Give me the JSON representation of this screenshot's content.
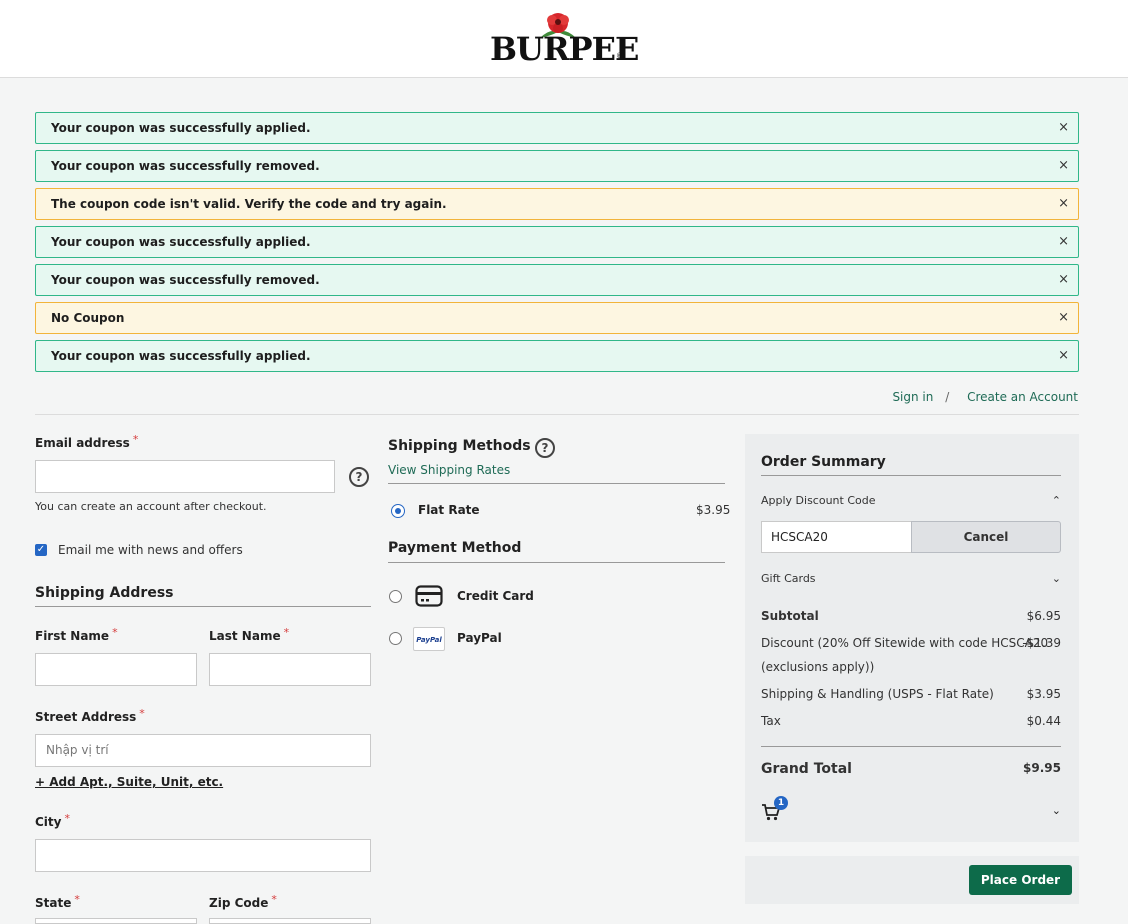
{
  "header": {
    "logo_text": "BURPEE",
    "logo_reg": "®"
  },
  "messages": [
    {
      "text": "Your coupon was successfully applied.",
      "type": "success"
    },
    {
      "text": "Your coupon was successfully removed.",
      "type": "success"
    },
    {
      "text": "The coupon code isn't valid. Verify the code and try again.",
      "type": "warning"
    },
    {
      "text": "Your coupon was successfully applied.",
      "type": "success"
    },
    {
      "text": "Your coupon was successfully removed.",
      "type": "success"
    },
    {
      "text": "No Coupon",
      "type": "warning"
    },
    {
      "text": "Your coupon was successfully applied.",
      "type": "success"
    }
  ],
  "close_glyph": "×",
  "auth": {
    "sign_in": "Sign in",
    "separator": "/",
    "create": "Create an Account"
  },
  "form": {
    "email_label": "Email address",
    "required_mark": "*",
    "email_note": "You can create an account after checkout.",
    "newsletter_label": "Email me with news and offers",
    "shipping_title": "Shipping Address",
    "first_name_label": "First Name",
    "last_name_label": "Last Name",
    "street_label": "Street Address",
    "street_placeholder": "Nhập vị trí",
    "add_apt": "+ Add Apt., Suite, Unit, etc.",
    "city_label": "City",
    "state_label": "State",
    "zip_label": "Zip Code"
  },
  "shipping": {
    "title": "Shipping Methods",
    "view_rates": "View Shipping Rates",
    "method_label": "Flat Rate",
    "method_price": "$3.95"
  },
  "payment": {
    "title": "Payment Method",
    "options": [
      {
        "label": "Credit Card",
        "icon": "credit-card-icon"
      },
      {
        "label": "PayPal",
        "icon": "paypal-icon",
        "icon_text": "PayPal"
      }
    ]
  },
  "summary": {
    "title": "Order Summary",
    "discount_label": "Apply Discount Code",
    "coupon_value": "HCSCA20",
    "cancel_label": "Cancel",
    "gift_cards_label": "Gift Cards",
    "subtotal_label": "Subtotal",
    "subtotal_value": "$6.95",
    "discount_line1": "Discount (20% Off Sitewide with code HCSCA20",
    "discount_line2": "(exclusions apply))",
    "discount_value": "-$1.39",
    "shipping_label": "Shipping & Handling (USPS - Flat Rate)",
    "shipping_value": "$3.95",
    "tax_label": "Tax",
    "tax_value": "$0.44",
    "grand_total_label": "Grand Total",
    "grand_total_value": "$9.95",
    "cart_count": "1"
  },
  "place_order_label": "Place Order",
  "colors": {
    "accent": "#0d6b4a",
    "success_border": "#30b789",
    "warning_border": "#f2b43a",
    "link": "#1f6b56",
    "checkbox": "#2466c4"
  }
}
